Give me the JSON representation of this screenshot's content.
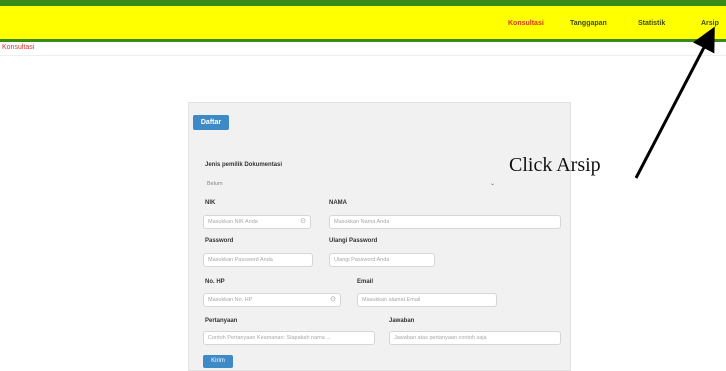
{
  "nav": {
    "items": [
      {
        "label": "Konsultasi",
        "active": true
      },
      {
        "label": "Tanggapan",
        "active": false
      },
      {
        "label": "Statistik",
        "active": false
      },
      {
        "label": "Arsip",
        "active": false
      }
    ]
  },
  "breadcrumb": "Konsultasi",
  "form": {
    "tab_label": "Daftar",
    "jenis_label": "Jenis pemilik Dokumentasi",
    "jenis_value": "Belum",
    "nik_label": "NIK",
    "nik_placeholder": "Masukkan NIK Anda",
    "nama_label": "NAMA",
    "nama_placeholder": "Masukkan Nama Anda",
    "password_label": "Password",
    "password_placeholder": "Masukkan Password Anda",
    "ulangi_label": "Ulangi Password",
    "ulangi_placeholder": "Ulangi Password Anda",
    "hp_label": "No. HP",
    "hp_placeholder": "Masukkan No. HP",
    "email_label": "Email",
    "email_placeholder": "Masukkan alamat Email",
    "pertanyaan_label": "Pertanyaan",
    "pertanyaan_placeholder": "Contoh Pertanyaan Keamanan: Siapakah nama ...",
    "jawaban_label": "Jawaban",
    "jawaban_placeholder": "Jawaban atas pertanyaan contoh saja",
    "submit_label": "Kirim"
  },
  "annotation": {
    "text": "Click Arsip"
  },
  "colors": {
    "topbar": "#ffff00",
    "topbar_border": "#3a8a1a",
    "accent": "#3d8ac7",
    "active_nav": "#d9362b"
  }
}
